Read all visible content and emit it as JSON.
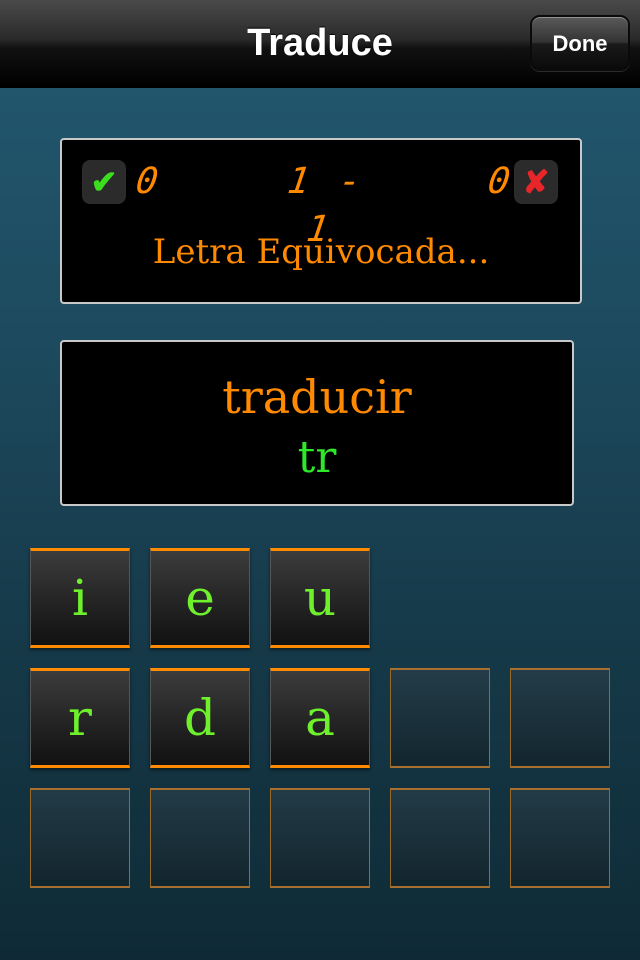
{
  "navbar": {
    "title": "Traduce",
    "done_label": "Done"
  },
  "score": {
    "correct_icon": "check-icon",
    "wrong_icon": "x-icon",
    "correct_glyph": "✔",
    "wrong_glyph": "✘",
    "correct_count": "0",
    "progress": "1 - 1",
    "wrong_count": "0",
    "status": "Letra Equivocada..."
  },
  "word": {
    "target": "traducir",
    "typed": "tr"
  },
  "tiles": {
    "row1": [
      "i",
      "e",
      "u"
    ],
    "row2": [
      "r",
      "d",
      "a"
    ]
  },
  "colors": {
    "accent_orange": "#ff8a00",
    "letter_green": "#6ef02c",
    "correct_green": "#3cdc1e",
    "wrong_red": "#e8262a"
  }
}
